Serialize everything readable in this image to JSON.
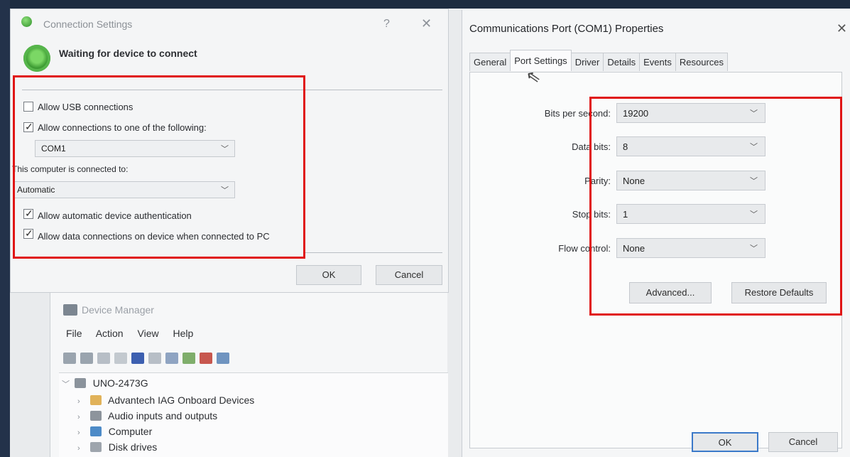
{
  "connection_dialog": {
    "title": "Connection Settings",
    "help": "?",
    "close": "✕",
    "status": "Waiting for device to connect",
    "allow_usb": {
      "label": "Allow USB connections",
      "checked": false
    },
    "allow_connections": {
      "label": "Allow connections to one of the following:",
      "checked": true
    },
    "port_value": "COM1",
    "connected_to_label": "This computer is connected to:",
    "connected_to_value": "Automatic",
    "allow_auth": {
      "label": "Allow automatic device authentication",
      "checked": true
    },
    "allow_data": {
      "label": "Allow data connections on device when connected to PC",
      "checked": true
    },
    "ok": "OK",
    "cancel": "Cancel"
  },
  "device_manager": {
    "title": "Device Manager",
    "menu": [
      "File",
      "Action",
      "View",
      "Help"
    ],
    "tree": {
      "root": "UNO-2473G",
      "children": [
        "Advantech IAG Onboard Devices",
        "Audio inputs and outputs",
        "Computer",
        "Disk drives"
      ]
    }
  },
  "properties_dialog": {
    "title": "Communications Port (COM1) Properties",
    "close": "✕",
    "tabs": [
      "General",
      "Port Settings",
      "Driver",
      "Details",
      "Events",
      "Resources"
    ],
    "active_tab": "Port Settings",
    "fields": {
      "bits_per_second": {
        "label": "Bits per second:",
        "value": "19200"
      },
      "data_bits": {
        "label": "Data bits:",
        "value": "8"
      },
      "parity": {
        "label": "Parity:",
        "value": "None"
      },
      "stop_bits": {
        "label": "Stop bits:",
        "value": "1"
      },
      "flow_control": {
        "label": "Flow control:",
        "value": "None"
      }
    },
    "advanced": "Advanced...",
    "restore_defaults": "Restore Defaults",
    "ok": "OK",
    "cancel": "Cancel"
  },
  "colors": {
    "highlight_border": "#e01515",
    "status_green": "#3d9b33"
  }
}
